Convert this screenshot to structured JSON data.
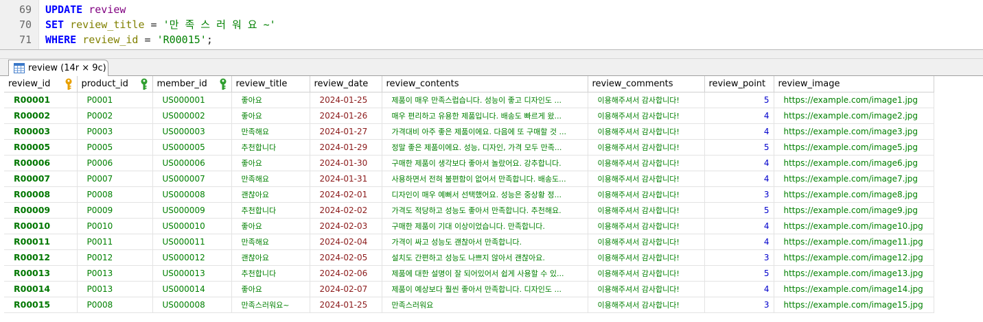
{
  "editor": {
    "lines": [
      {
        "num": "69",
        "parts": [
          {
            "t": "UPDATE",
            "c": "kw"
          },
          {
            "t": " ",
            "c": "op"
          },
          {
            "t": "review",
            "c": "tbl"
          }
        ]
      },
      {
        "num": "70",
        "parts": [
          {
            "t": "SET",
            "c": "kw"
          },
          {
            "t": " ",
            "c": "op"
          },
          {
            "t": "review_title",
            "c": "col"
          },
          {
            "t": " = ",
            "c": "op"
          },
          {
            "t": "'만 족 스 러 워 요 ~'",
            "c": "str"
          }
        ]
      },
      {
        "num": "71",
        "parts": [
          {
            "t": "WHERE",
            "c": "kw"
          },
          {
            "t": " ",
            "c": "op"
          },
          {
            "t": "review_id",
            "c": "col"
          },
          {
            "t": " = ",
            "c": "op"
          },
          {
            "t": "'R00015'",
            "c": "str"
          },
          {
            "t": ";",
            "c": "op"
          }
        ]
      }
    ]
  },
  "result_tab": {
    "label": "review (14r × 9c)",
    "icon": "table-grid-icon"
  },
  "colors": {
    "keyword": "#0000ff",
    "table": "#800080",
    "column": "#808000",
    "string": "#008000",
    "cell_text": "#008000",
    "date_text": "#8b1a1a",
    "number_text": "#0000cc",
    "primary_key": "#e8a000",
    "foreign_key": "#2e9e2e"
  },
  "grid": {
    "columns": [
      {
        "label": "review_id",
        "key": "pk",
        "key_icon": "primary-key-icon",
        "kind": "pk"
      },
      {
        "label": "product_id",
        "key": "fk",
        "key_icon": "foreign-key-icon",
        "kind": "text"
      },
      {
        "label": "member_id",
        "key": "fk",
        "key_icon": "foreign-key-icon",
        "kind": "text"
      },
      {
        "label": "review_title",
        "kind": "ko"
      },
      {
        "label": "review_date",
        "kind": "date"
      },
      {
        "label": "review_contents",
        "kind": "ko"
      },
      {
        "label": "review_comments",
        "kind": "ko"
      },
      {
        "label": "review_point",
        "kind": "num"
      },
      {
        "label": "review_image",
        "kind": "text"
      }
    ],
    "rows": [
      [
        "R00001",
        "P0001",
        "US000001",
        "좋아요",
        "2024-01-25",
        "제품이 매우 만족스럽습니다. 성능이 좋고 디자인도 ...",
        "이용해주셔서 감사합니다!",
        "5",
        "https://example.com/image1.jpg"
      ],
      [
        "R00002",
        "P0002",
        "US000002",
        "좋아요",
        "2024-01-26",
        "매우 편리하고 유용한 제품입니다. 배송도 빠르게 왔...",
        "이용해주셔서 감사합니다!",
        "4",
        "https://example.com/image2.jpg"
      ],
      [
        "R00003",
        "P0003",
        "US000003",
        "만족해요",
        "2024-01-27",
        "가격대비 아주 좋은 제품이에요. 다음에 또 구매할 것 ...",
        "이용해주셔서 감사합니다!",
        "4",
        "https://example.com/image3.jpg"
      ],
      [
        "R00005",
        "P0005",
        "US000005",
        "추천합니다",
        "2024-01-29",
        "정말 좋은 제품이에요. 성능, 디자인, 가격 모두 만족...",
        "이용해주셔서 감사합니다!",
        "5",
        "https://example.com/image5.jpg"
      ],
      [
        "R00006",
        "P0006",
        "US000006",
        "좋아요",
        "2024-01-30",
        "구매한 제품이 생각보다 좋아서 놀랐어요. 강추합니다.",
        "이용해주셔서 감사합니다!",
        "4",
        "https://example.com/image6.jpg"
      ],
      [
        "R00007",
        "P0007",
        "US000007",
        "만족해요",
        "2024-01-31",
        "사용하면서 전혀 불편함이 없어서 만족합니다. 배송도...",
        "이용해주셔서 감사합니다!",
        "4",
        "https://example.com/image7.jpg"
      ],
      [
        "R00008",
        "P0008",
        "US000008",
        "괜찮아요",
        "2024-02-01",
        "디자인이 매우 예뻐서 선택했어요. 성능은 중상황 정...",
        "이용해주셔서 감사합니다!",
        "3",
        "https://example.com/image8.jpg"
      ],
      [
        "R00009",
        "P0009",
        "US000009",
        "추천합니다",
        "2024-02-02",
        "가격도 적당하고 성능도 좋아서 만족합니다. 추천해요.",
        "이용해주셔서 감사합니다!",
        "5",
        "https://example.com/image9.jpg"
      ],
      [
        "R00010",
        "P0010",
        "US000010",
        "좋아요",
        "2024-02-03",
        "구매한 제품이 기대 이상이었습니다. 만족합니다.",
        "이용해주셔서 감사합니다!",
        "4",
        "https://example.com/image10.jpg"
      ],
      [
        "R00011",
        "P0011",
        "US000011",
        "만족해요",
        "2024-02-04",
        "가격이 싸고 성능도 괜찮아서 만족합니다.",
        "이용해주셔서 감사합니다!",
        "4",
        "https://example.com/image11.jpg"
      ],
      [
        "R00012",
        "P0012",
        "US000012",
        "괜찮아요",
        "2024-02-05",
        "설치도 간편하고 성능도 나쁘지 않아서 괜찮아요.",
        "이용해주셔서 감사합니다!",
        "3",
        "https://example.com/image12.jpg"
      ],
      [
        "R00013",
        "P0013",
        "US000013",
        "추천합니다",
        "2024-02-06",
        "제품에 대한 설명이 잘 되어있어서 쉽게 사용할 수 있...",
        "이용해주셔서 감사합니다!",
        "5",
        "https://example.com/image13.jpg"
      ],
      [
        "R00014",
        "P0013",
        "US000014",
        "좋아요",
        "2024-02-07",
        "제품이 예상보다 훨씬 좋아서 만족합니다. 디자인도 ...",
        "이용해주셔서 감사합니다!",
        "4",
        "https://example.com/image14.jpg"
      ],
      [
        "R00015",
        "P0008",
        "US000008",
        "만족스러워요~",
        "2024-01-25",
        "만족스러워요",
        "이용해주셔서 감사합니다!",
        "3",
        "https://example.com/image15.jpg"
      ]
    ]
  }
}
